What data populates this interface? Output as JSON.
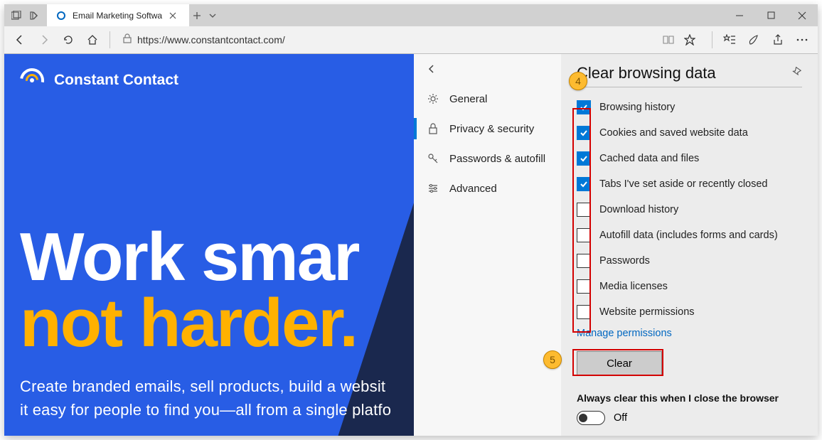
{
  "titlebar": {
    "tab_title": "Email Marketing Softwa"
  },
  "address": {
    "url": "https://www.constantcontact.com/"
  },
  "page": {
    "brand": "Constant Contact",
    "hero_line1": "Work smar",
    "hero_line2": "not harder.",
    "tagline1": "Create branded emails, sell products, build a websit",
    "tagline2": "it easy for people to find you—all from a single platfo"
  },
  "settings_menu": {
    "items": [
      {
        "label": "General"
      },
      {
        "label": "Privacy & security"
      },
      {
        "label": "Passwords & autofill"
      },
      {
        "label": "Advanced"
      }
    ]
  },
  "panel": {
    "title": "Clear browsing data",
    "options": [
      {
        "label": "Browsing history",
        "checked": true
      },
      {
        "label": "Cookies and saved website data",
        "checked": true
      },
      {
        "label": "Cached data and files",
        "checked": true
      },
      {
        "label": "Tabs I've set aside or recently closed",
        "checked": true
      },
      {
        "label": "Download history",
        "checked": false
      },
      {
        "label": "Autofill data (includes forms and cards)",
        "checked": false
      },
      {
        "label": "Passwords",
        "checked": false
      },
      {
        "label": "Media licenses",
        "checked": false
      },
      {
        "label": "Website permissions",
        "checked": false
      }
    ],
    "manage_link": "Manage permissions",
    "clear_button": "Clear",
    "always_label": "Always clear this when I close the browser",
    "toggle_state": "Off"
  },
  "callouts": {
    "c4": "4",
    "c5": "5"
  }
}
